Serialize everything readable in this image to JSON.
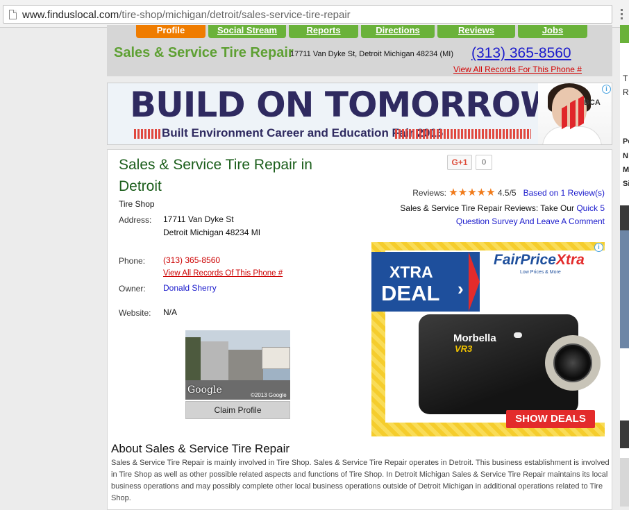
{
  "browser": {
    "url_domain": "www.finduslocal.com",
    "url_path": "/tire-shop/michigan/detroit/sales-service-tire-repair"
  },
  "nav": {
    "tabs": [
      {
        "label": "Profile",
        "active": true
      },
      {
        "label": "Social Stream"
      },
      {
        "label": "Reports"
      },
      {
        "label": "Directions"
      },
      {
        "label": "Reviews"
      },
      {
        "label": "Jobs"
      }
    ]
  },
  "header": {
    "title": "Sales & Service Tire Repair",
    "address": "17711 Van Dyke St, Detroit Michigan 48234 (MI)",
    "phone": "(313) 365-8560",
    "view_all": "View All Records For This Phone #"
  },
  "right_strip": {
    "letters": [
      "T",
      "R",
      "Po",
      "N",
      "M",
      "Si"
    ]
  },
  "banner_ad": {
    "headline": "BUILD ON TOMORROW",
    "subline": "Built Environment Career and Education Fair 2016",
    "brand": "BCA",
    "info_icon": "i"
  },
  "listing": {
    "title": "Sales & Service Tire Repair in Detroit",
    "gplus_label": "G+1",
    "gplus_count": "0",
    "reviews_label": "Reviews:",
    "stars": "★★★★★",
    "rating": "4.5/5",
    "based_on": "Based on 1 Review(s)",
    "survey_prefix": "Sales & Service Tire Repair Reviews: Take Our",
    "survey_link_1": "Quick 5",
    "survey_link_2": "Question Survey And Leave A Comment",
    "category": "Tire Shop",
    "address_label": "Address:",
    "address_line1": "17711 Van Dyke St",
    "address_line2": "Detroit Michigan 48234 MI",
    "phone_label": "Phone:",
    "phone": "(313) 365-8560",
    "phone_records": "View All Records Of This Phone #",
    "owner_label": "Owner:",
    "owner": "Donald Sherry",
    "website_label": "Website:",
    "website": "N/A",
    "streetview_brand": "Google",
    "streetview_copyright": "©2013 Google",
    "claim_button": "Claim Profile"
  },
  "square_ad": {
    "xtra": "XTRA",
    "deal": "DEAL",
    "chevron": "›",
    "brand_main": "FairPrice",
    "brand_x": "Xtra",
    "tagline": "Low Prices & More",
    "product_brand": "Morbella",
    "product_model": "VR3",
    "cta": "SHOW DEALS",
    "info_icon": "i"
  },
  "about": {
    "title": "About Sales & Service Tire Repair",
    "text": "Sales & Service Tire Repair is mainly involved in Tire Shop. Sales & Service Tire Repair operates in Detroit. This business establishment is involved in Tire Shop as well as other possible related aspects and functions of Tire Shop. In Detroit Michigan Sales & Service Tire Repair maintains its local business operations and may possibly complete other local business operations outside of Detroit Michigan in additional operations related to Tire Shop."
  },
  "colors": {
    "nav_green": "#6ab23a",
    "nav_orange": "#ef7c00",
    "title_green": "#5ea033",
    "link_blue": "#1a1acc",
    "link_red": "#d40000"
  }
}
